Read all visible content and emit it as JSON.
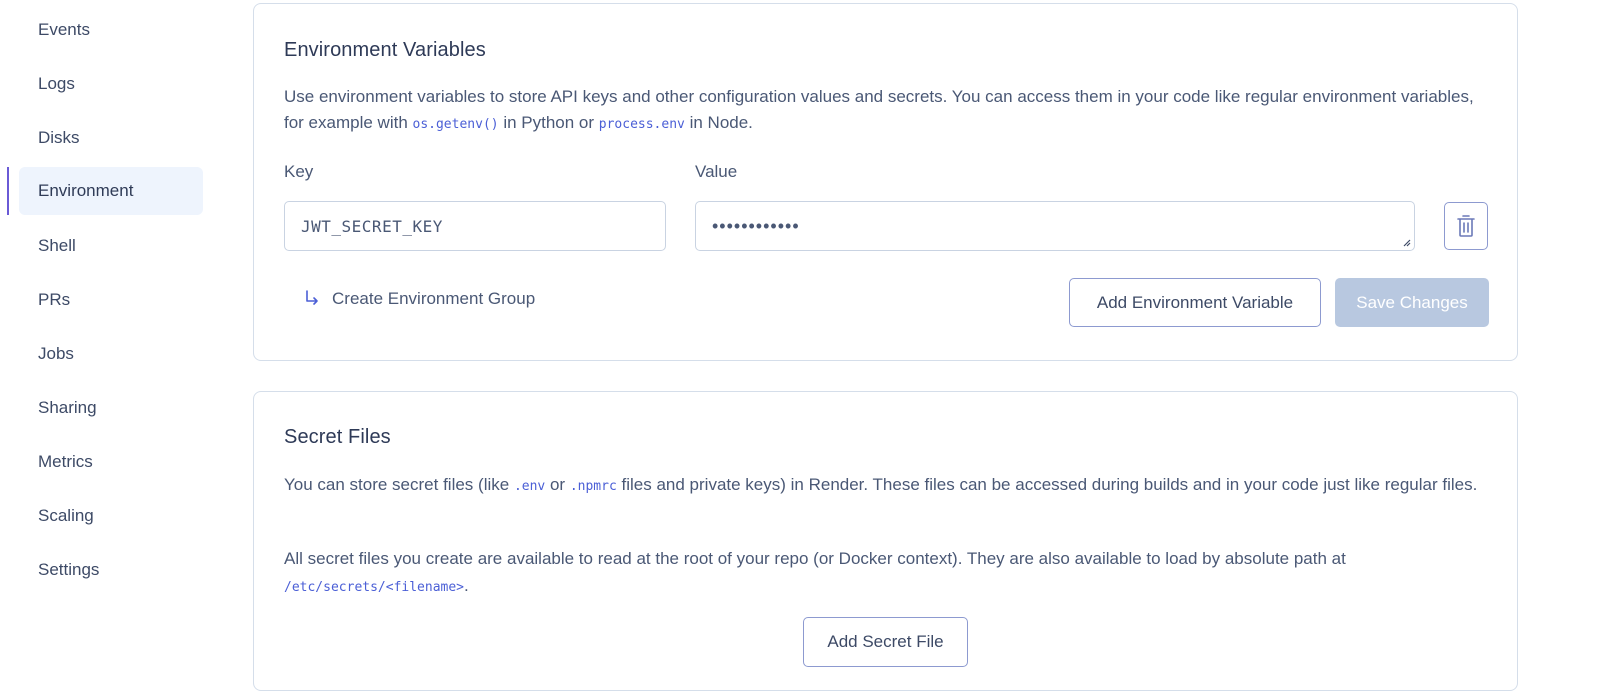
{
  "sidebar": {
    "items": [
      {
        "label": "Events"
      },
      {
        "label": "Logs"
      },
      {
        "label": "Disks"
      },
      {
        "label": "Environment",
        "active": true
      },
      {
        "label": "Shell"
      },
      {
        "label": "PRs"
      },
      {
        "label": "Jobs"
      },
      {
        "label": "Sharing"
      },
      {
        "label": "Metrics"
      },
      {
        "label": "Scaling"
      },
      {
        "label": "Settings"
      }
    ]
  },
  "env_vars": {
    "title": "Environment Variables",
    "desc_part1": "Use environment variables to store API keys and other configuration values and secrets. You can access them in your code like regular environment variables, for example with ",
    "desc_code1": "os.getenv()",
    "desc_part2": " in Python or ",
    "desc_code2": "process.env",
    "desc_part3": " in Node.",
    "key_label": "Key",
    "value_label": "Value",
    "key_value": "JWT_SECRET_KEY",
    "value_masked": "••••••••••••",
    "create_group_label": "Create Environment Group",
    "add_button": "Add Environment Variable",
    "save_button": "Save Changes"
  },
  "secret_files": {
    "title": "Secret Files",
    "p1_part1": "You can store secret files (like ",
    "p1_code1": ".env",
    "p1_part2": " or ",
    "p1_code2": ".npmrc",
    "p1_part3": " files and private keys) in Render. These files can be accessed during builds and in your code just like regular files.",
    "p2_part1": "All secret files you create are available to read at the root of your repo (or Docker context). They are also available to load by absolute path at ",
    "p2_code": "/etc/secrets/<filename>",
    "p2_part2": ".",
    "add_button": "Add Secret File"
  },
  "colors": {
    "accent": "#6a5ad6",
    "active_bg": "#eef4fd",
    "code": "#4b5fd6",
    "disabled_button": "#b8c8e0"
  }
}
